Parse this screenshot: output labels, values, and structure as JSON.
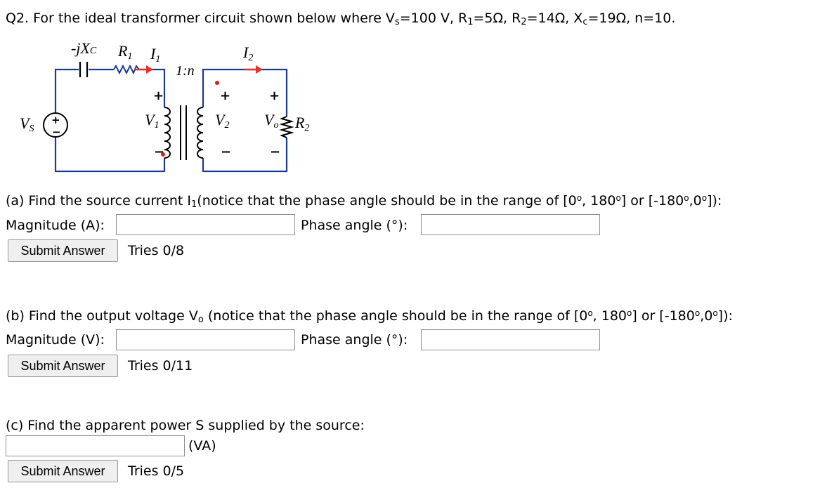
{
  "question": {
    "prefix": "Q2. For the ideal transformer circuit shown below where V",
    "vs_sub": "s",
    "mid1": "=100 V, R",
    "r1_sub": "1",
    "mid2": "=5Ω, R",
    "r2_sub": "2",
    "mid3": "=14Ω, X",
    "xc_sub": "c",
    "suffix": "=19Ω, n=10."
  },
  "diagram": {
    "xc_label": "-jX",
    "xc_sub": "C",
    "r1_label": "R",
    "r1_sub": "1",
    "i1_label": "I",
    "i1_sub": "1",
    "ratio_label": "1:n",
    "i2_label": "I",
    "i2_sub": "2",
    "vs_label": "V",
    "vs_sub": "S",
    "v1_label": "V",
    "v1_sub": "1",
    "v2_label": "V",
    "v2_sub": "2",
    "vo_label": "V",
    "vo_sub": "o",
    "r2_label": "R",
    "r2_sub": "2",
    "plus": "+",
    "minus": "−",
    "source_plus": "+",
    "source_minus": "−",
    "colors": {
      "wire": "#1f3a93",
      "arrow": "#e8332a",
      "dot": "#d42020"
    }
  },
  "part_a": {
    "prompt_pre": "(a) Find the source current I",
    "prompt_sub": "1",
    "prompt_mid": "(notice that the phase angle should be in the range of [0",
    "deg1": "o",
    "prompt_mid2": ", 180",
    "deg2": "o",
    "prompt_mid3": "] or [-180",
    "deg3": "o",
    "prompt_mid4": ",0",
    "deg4": "o",
    "prompt_end": "]):",
    "magnitude_label": "Magnitude (A):",
    "magnitude_value": "",
    "phase_label": "Phase angle (°):",
    "phase_value": "",
    "submit_label": "Submit Answer",
    "tries": "Tries 0/8"
  },
  "part_b": {
    "prompt_pre": "(b) Find the output voltage V",
    "prompt_sub": "o",
    "prompt_mid": " (notice that the phase angle should be in the range of [0",
    "deg1": "o",
    "prompt_mid2": ", 180",
    "deg2": "o",
    "prompt_mid3": "] or [-180",
    "deg3": "o",
    "prompt_mid4": ",0",
    "deg4": "o",
    "prompt_end": "]):",
    "magnitude_label": "Magnitude (V):",
    "magnitude_value": "",
    "phase_label": "Phase angle (°):",
    "phase_value": "",
    "submit_label": "Submit Answer",
    "tries": "Tries 0/11"
  },
  "part_c": {
    "prompt": "(c) Find the apparent power S supplied by the source:",
    "value": "",
    "unit": "(VA)",
    "submit_label": "Submit Answer",
    "tries": "Tries 0/5"
  }
}
